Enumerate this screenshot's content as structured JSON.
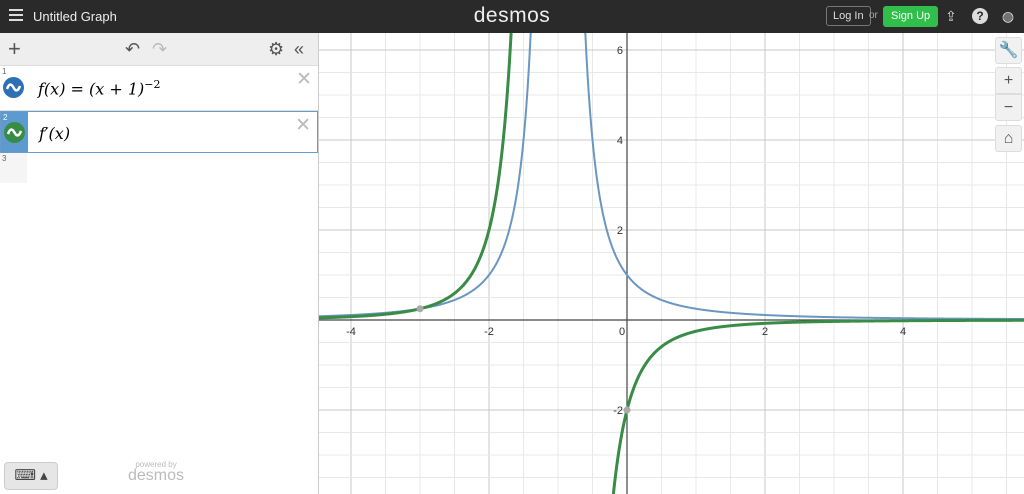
{
  "header": {
    "title": "Untitled Graph",
    "logo": "desmos",
    "login": "Log In",
    "or": "or",
    "signup": "Sign Up",
    "signup_color": "#2fbf4a"
  },
  "toolbar": {
    "add": "+",
    "undo": "↶",
    "redo": "↷",
    "settings": "⚙",
    "collapse": "«"
  },
  "expressions": [
    {
      "num": "1",
      "latex": "f(x) = (x + 1)",
      "sup": "−2",
      "color": "#2d70b3"
    },
    {
      "num": "2",
      "latex": "f′(x)",
      "color": "#388c46",
      "selected": true
    },
    {
      "num": "3",
      "latex": ""
    }
  ],
  "footer": {
    "keyboard": "⌨ ▴",
    "powered_by": "powered by",
    "brand": "desmos"
  },
  "controls": {
    "wrench": "🔧",
    "zoom_in": "+",
    "zoom_out": "−",
    "home": "⌂"
  },
  "chart_data": {
    "type": "line",
    "xlim": [
      -4.5,
      5.7
    ],
    "ylim": [
      -3.9,
      6.35
    ],
    "x_ticks": [
      -4,
      -2,
      0,
      2,
      4
    ],
    "y_ticks": [
      -2,
      2,
      4,
      6
    ],
    "x_tick_labels": [
      "-4",
      "-2",
      "0",
      "2",
      "4"
    ],
    "y_tick_labels": [
      "-2",
      "2",
      "4",
      "6"
    ],
    "minor_step": 0.5,
    "series": [
      {
        "name": "f(x)=(x+1)^-2",
        "color": "#6b96c2"
      },
      {
        "name": "f'(x)=-2(x+1)^-3",
        "color": "#388c46"
      }
    ],
    "points": [
      {
        "x": -3,
        "y": 0.25
      },
      {
        "x": 0,
        "y": -2
      }
    ]
  }
}
